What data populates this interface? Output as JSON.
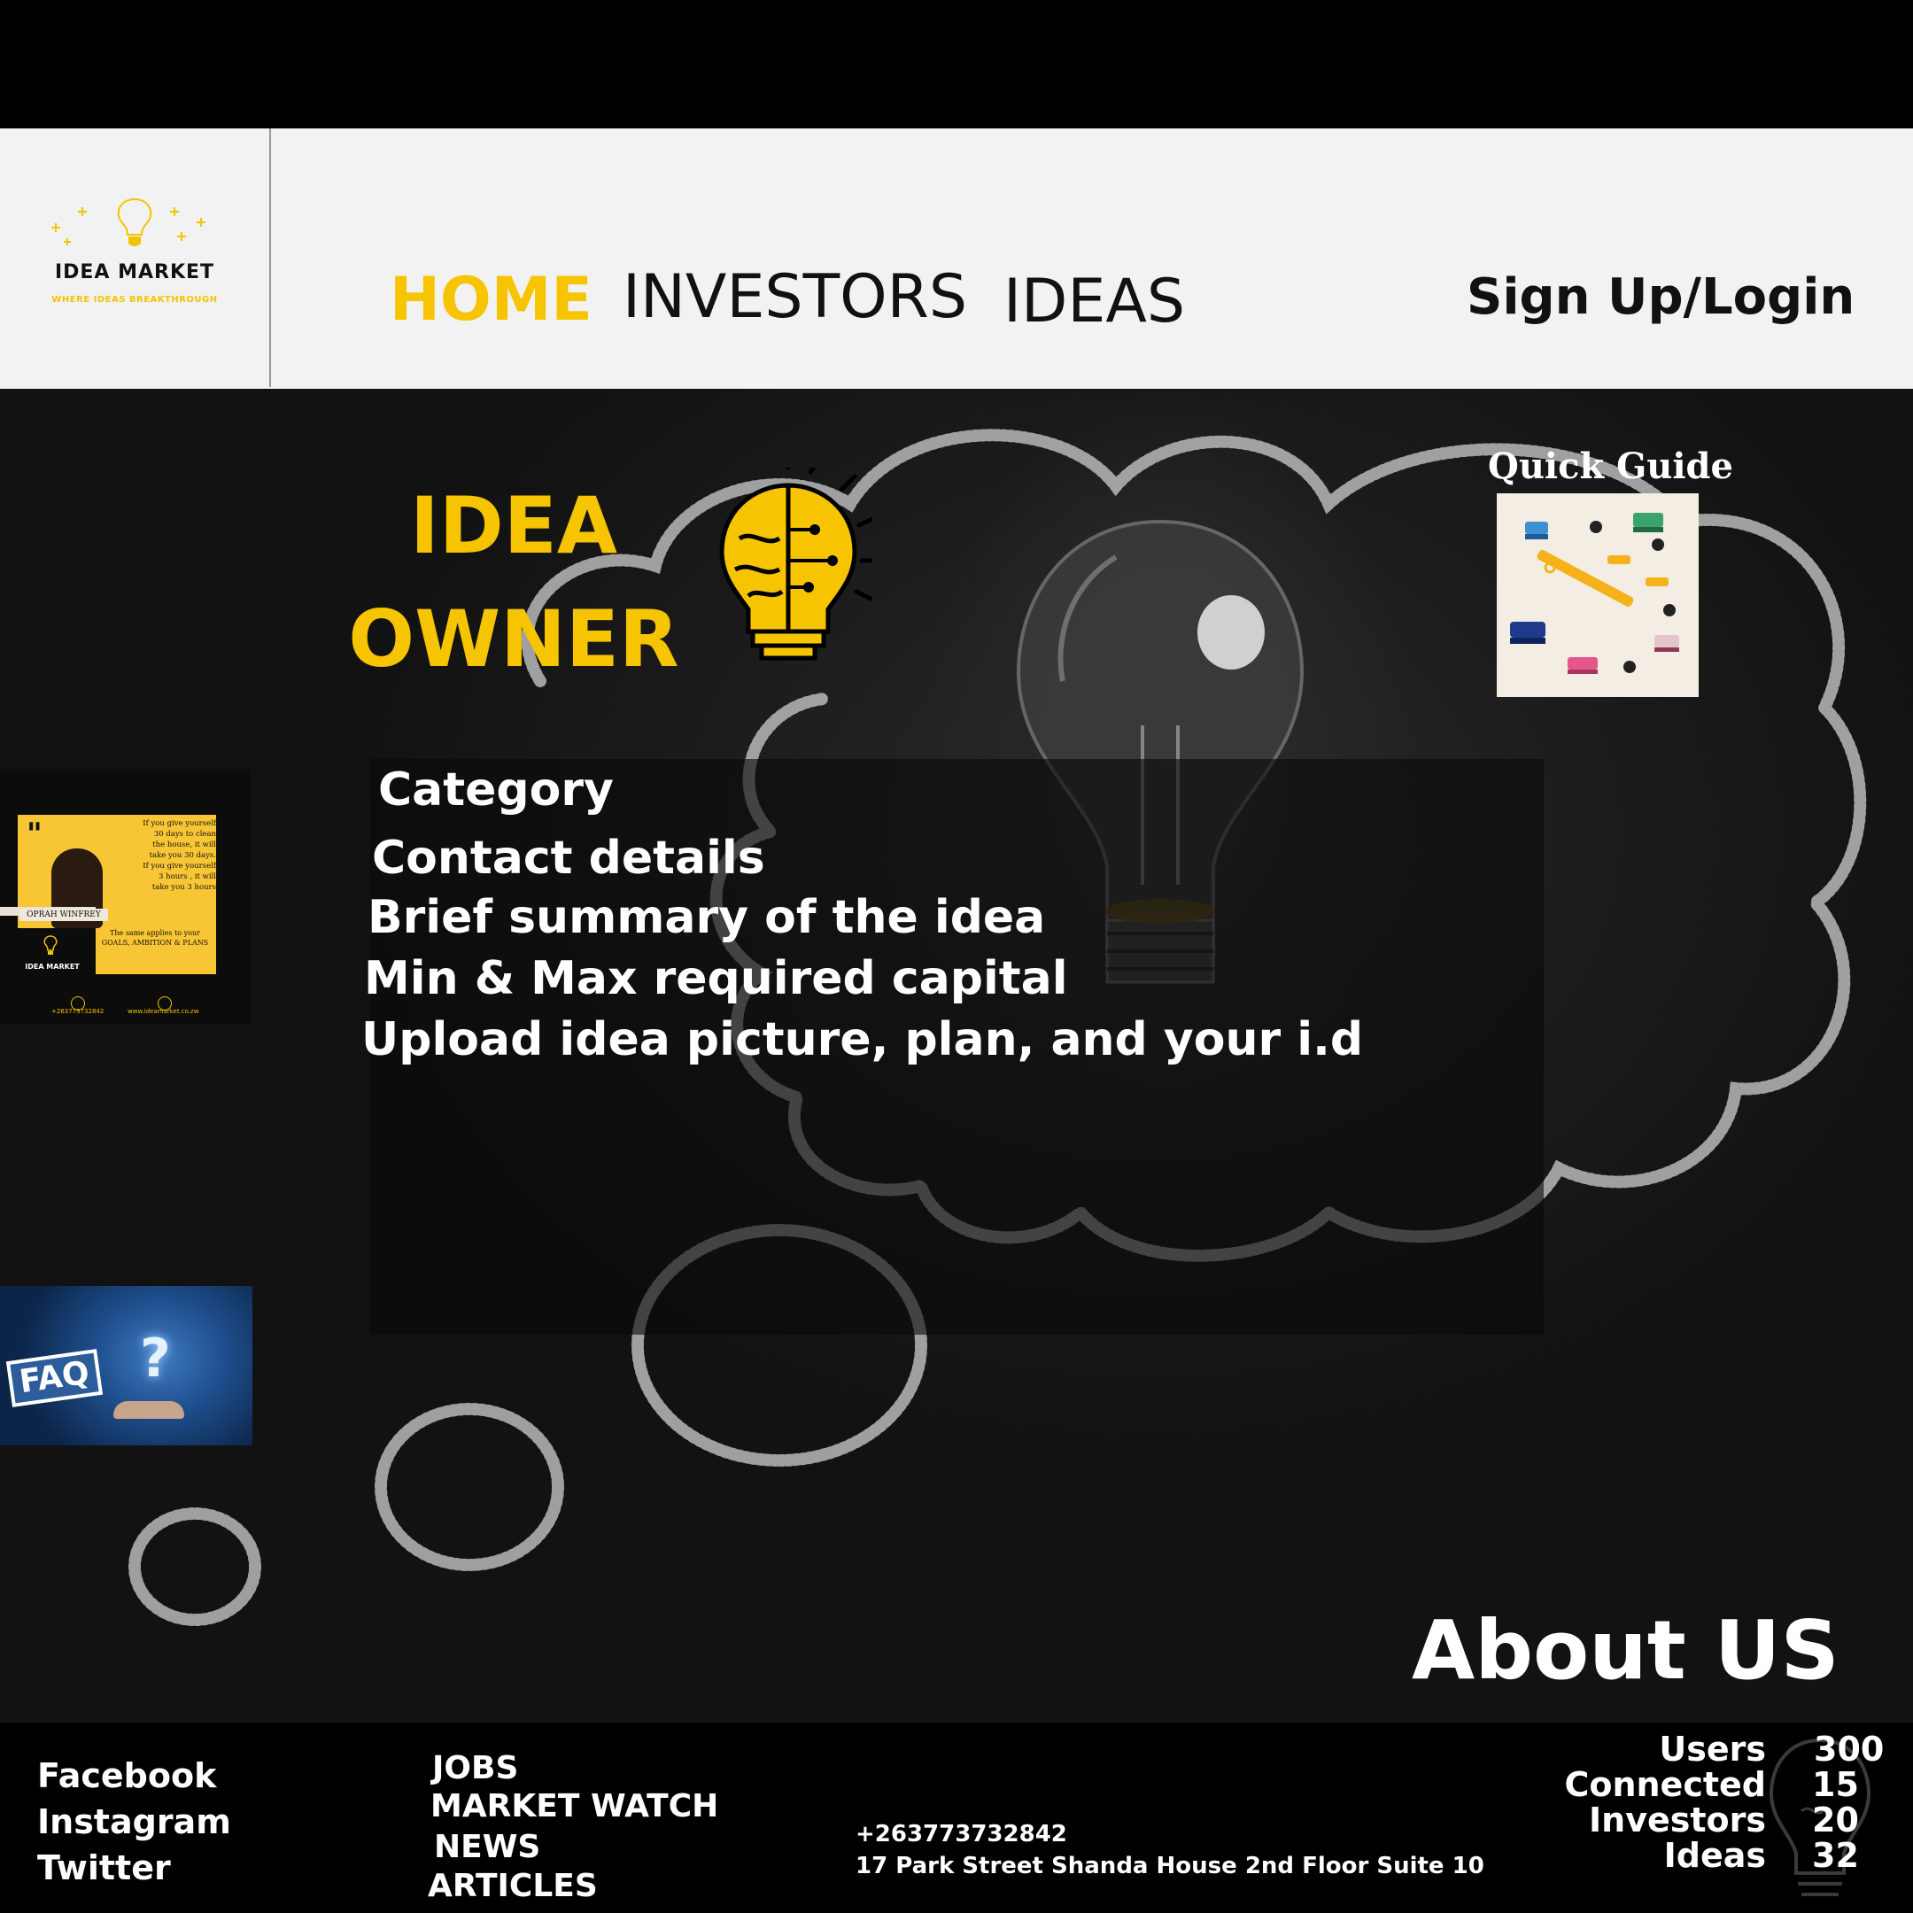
{
  "colors": {
    "accent": "#f6c400",
    "header_bg": "#f2f2f2",
    "footer_bg": "#000000"
  },
  "logo": {
    "brand": "IDEA MARKET",
    "tagline": "WHERE IDEAS BREAKTHROUGH",
    "icon": "lightbulb-icon"
  },
  "nav": {
    "home": "HOME",
    "investors": "INVESTORS",
    "ideas": "IDEAS",
    "signup": "Sign Up/Login",
    "active": "HOME"
  },
  "hero": {
    "title_line1": "IDEA",
    "title_line2": "OWNER",
    "icon": "brain-bulb-icon",
    "quick_guide": "Quick Guide",
    "info_items": [
      "Category",
      "Contact details",
      "Brief summary of the idea",
      "Min & Max required capital",
      "Upload idea picture, plan, and your i.d"
    ],
    "about": "About US"
  },
  "quote_card": {
    "quote": "If you give yourself 30 days to clean the house, it will take you 30 days. If you give yourself 3 hours , it will take you 3 hours",
    "author": "OPRAH WINFREY",
    "subtext": "The same applies to your GOALS, AMBITION & PLANS",
    "brand": "IDEA MARKET",
    "phone": "+263773732842",
    "website": "www.ideamarket.co.zw"
  },
  "faq_card": {
    "label": "FAQ",
    "mark": "?"
  },
  "footer": {
    "social": [
      "Facebook",
      "Instagram",
      "Twitter"
    ],
    "links": [
      "JOBS",
      "MARKET WATCH",
      "NEWS",
      "ARTICLES"
    ],
    "phone": "+263773732842",
    "address": "17 Park Street Shanda House 2nd Floor Suite 10",
    "stats": [
      {
        "label": "Users",
        "value": "300"
      },
      {
        "label": "Connected",
        "value": "15"
      },
      {
        "label": "Investors",
        "value": "20"
      },
      {
        "label": "Ideas",
        "value": "32"
      }
    ]
  }
}
